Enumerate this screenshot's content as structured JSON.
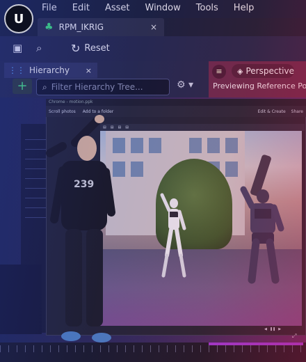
{
  "menubar": {
    "logo": "ue-logo",
    "items": [
      "File",
      "Edit",
      "Asset",
      "Window",
      "Tools",
      "Help"
    ]
  },
  "asset_tab": {
    "title": "RPM_IKRIG",
    "icon": "puppet-icon",
    "close": "×"
  },
  "toolbar": {
    "reset_label": "Reset",
    "save_icon": "save-icon",
    "browse_icon": "browse-icon"
  },
  "hierarchy": {
    "tab_label": "Hierarchy",
    "close": "×",
    "add": "+",
    "search_placeholder": "Filter Hierarchy Tree..."
  },
  "viewport": {
    "perspective_label": "Perspective",
    "preview_text": "Previewing Reference Pose"
  },
  "inner_window": {
    "title": "Chrome - motion.ppk",
    "tools": [
      "Scroll photos",
      "Add to a folder"
    ],
    "right_actions": [
      "Edit & Create",
      "Share"
    ]
  },
  "colors": {
    "accent_green": "#3fe07a",
    "timeline_purple": "#9b3bd6",
    "menubar_bg": "#18203a"
  }
}
